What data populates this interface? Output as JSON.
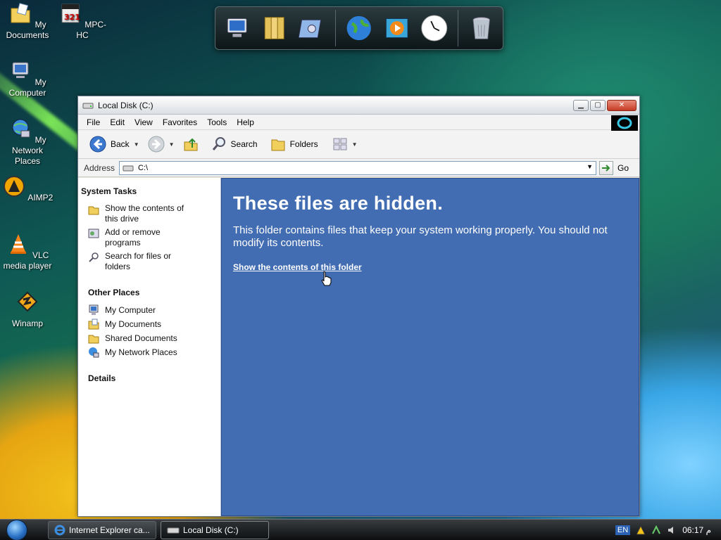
{
  "desktop": {
    "icons": [
      {
        "label": "My Documents"
      },
      {
        "label": "MPC-HC"
      },
      {
        "label": "My Computer"
      },
      {
        "label": "My Network Places"
      },
      {
        "label": "AIMP2"
      },
      {
        "label": "VLC media player"
      },
      {
        "label": "Winamp"
      }
    ]
  },
  "dock": {
    "items": [
      "computer-icon",
      "documents-icon",
      "control-panel-icon",
      "globe-icon",
      "media-player-icon",
      "clock-icon",
      "recycle-bin-icon"
    ]
  },
  "window": {
    "title": "Local Disk (C:)",
    "menu": [
      "File",
      "Edit",
      "View",
      "Favorites",
      "Tools",
      "Help"
    ],
    "toolbar": {
      "back_label": "Back",
      "search_label": "Search",
      "folders_label": "Folders"
    },
    "address": {
      "label": "Address",
      "value": "C:\\",
      "go_label": "Go"
    },
    "system_tasks": {
      "heading": "System Tasks",
      "items": [
        {
          "label": "Show the contents of this drive",
          "icon": "folder-icon"
        },
        {
          "label": "Add or remove programs",
          "icon": "programs-icon"
        },
        {
          "label": "Search for files or folders",
          "icon": "search-icon"
        }
      ]
    },
    "other_places": {
      "heading": "Other Places",
      "items": [
        {
          "label": "My Computer",
          "icon": "computer-icon"
        },
        {
          "label": "My Documents",
          "icon": "documents-icon"
        },
        {
          "label": "Shared Documents",
          "icon": "folder-icon"
        },
        {
          "label": "My Network Places",
          "icon": "network-icon"
        }
      ]
    },
    "details": {
      "heading": "Details"
    },
    "content": {
      "heading": "These files are hidden.",
      "message": "This folder contains files that keep your system working properly. You should not modify its contents.",
      "link": "Show the contents of this folder"
    }
  },
  "taskbar": {
    "buttons": [
      {
        "label": "Internet Explorer ca...",
        "icon": "ie-icon"
      },
      {
        "label": "Local Disk (C:)",
        "icon": "drive-icon"
      }
    ],
    "language": "EN",
    "clock": "06:17 م"
  },
  "colors": {
    "content_bg": "#426db3",
    "taskbar_bg": "#1c1f22"
  }
}
